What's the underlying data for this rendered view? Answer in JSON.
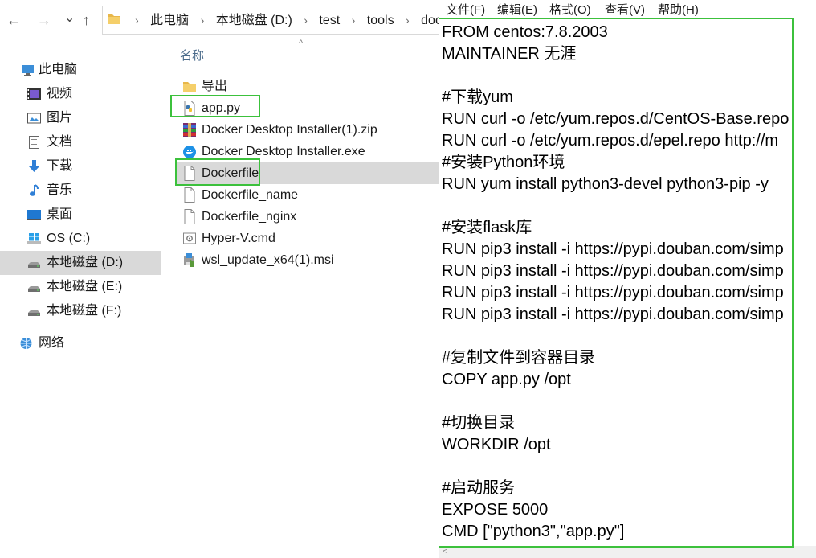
{
  "explorer": {
    "nav": {
      "back": "←",
      "forward": "→",
      "recent": "⌄",
      "up": "↑"
    },
    "breadcrumbs": [
      "此电脑",
      "本地磁盘 (D:)",
      "test",
      "tools",
      "docker"
    ],
    "sidebar": [
      {
        "label": "此电脑",
        "icon": "computer-icon"
      },
      {
        "label": "视频",
        "icon": "video-icon"
      },
      {
        "label": "图片",
        "icon": "pictures-icon"
      },
      {
        "label": "文档",
        "icon": "documents-icon"
      },
      {
        "label": "下载",
        "icon": "download-icon"
      },
      {
        "label": "音乐",
        "icon": "music-icon"
      },
      {
        "label": "桌面",
        "icon": "desktop-icon"
      },
      {
        "label": "OS (C:)",
        "icon": "windows-drive-icon"
      },
      {
        "label": "本地磁盘 (D:)",
        "icon": "drive-icon",
        "selected": true
      },
      {
        "label": "本地磁盘 (E:)",
        "icon": "drive-icon"
      },
      {
        "label": "本地磁盘 (F:)",
        "icon": "drive-icon"
      },
      {
        "label": "网络",
        "icon": "network-icon"
      }
    ],
    "column_header": "名称",
    "sort_arrow": "^",
    "files": [
      {
        "name": "导出",
        "icon": "folder-icon"
      },
      {
        "name": "app.py",
        "icon": "python-file-icon",
        "highlighted": true
      },
      {
        "name": "Docker Desktop Installer(1).zip",
        "icon": "winrar-archive-icon"
      },
      {
        "name": "Docker Desktop Installer.exe",
        "icon": "docker-icon"
      },
      {
        "name": "Dockerfile",
        "icon": "file-icon",
        "selected": true,
        "highlighted": true
      },
      {
        "name": "Dockerfile_name",
        "icon": "file-icon"
      },
      {
        "name": "Dockerfile_nginx",
        "icon": "file-icon"
      },
      {
        "name": "Hyper-V.cmd",
        "icon": "cmd-file-icon"
      },
      {
        "name": "wsl_update_x64(1).msi",
        "icon": "msi-installer-icon"
      }
    ]
  },
  "notepad": {
    "menu": [
      "文件(F)",
      "编辑(E)",
      "格式(O)",
      "查看(V)",
      "帮助(H)"
    ],
    "lines": [
      "FROM centos:7.8.2003",
      "MAINTAINER 无涯",
      "",
      "#下载yum",
      "RUN curl -o /etc/yum.repos.d/CentOS-Base.repo",
      "RUN curl -o /etc/yum.repos.d/epel.repo http://m",
      "#安装Python环境",
      "RUN yum install python3-devel python3-pip -y",
      "",
      "#安装flask库",
      "RUN pip3 install -i https://pypi.douban.com/simp",
      "RUN pip3 install -i https://pypi.douban.com/simp",
      "RUN pip3 install -i https://pypi.douban.com/simp",
      "RUN pip3 install -i https://pypi.douban.com/simp",
      "",
      "#复制文件到容器目录",
      "COPY app.py /opt",
      "",
      "#切换目录",
      "WORKDIR /opt",
      "",
      "#启动服务",
      "EXPOSE 5000",
      "CMD [\"python3\",\"app.py\"]"
    ],
    "scroll_left": "<"
  },
  "colors": {
    "highlight_box": "#3cc13c",
    "selected_bg": "#d9d9d9"
  }
}
